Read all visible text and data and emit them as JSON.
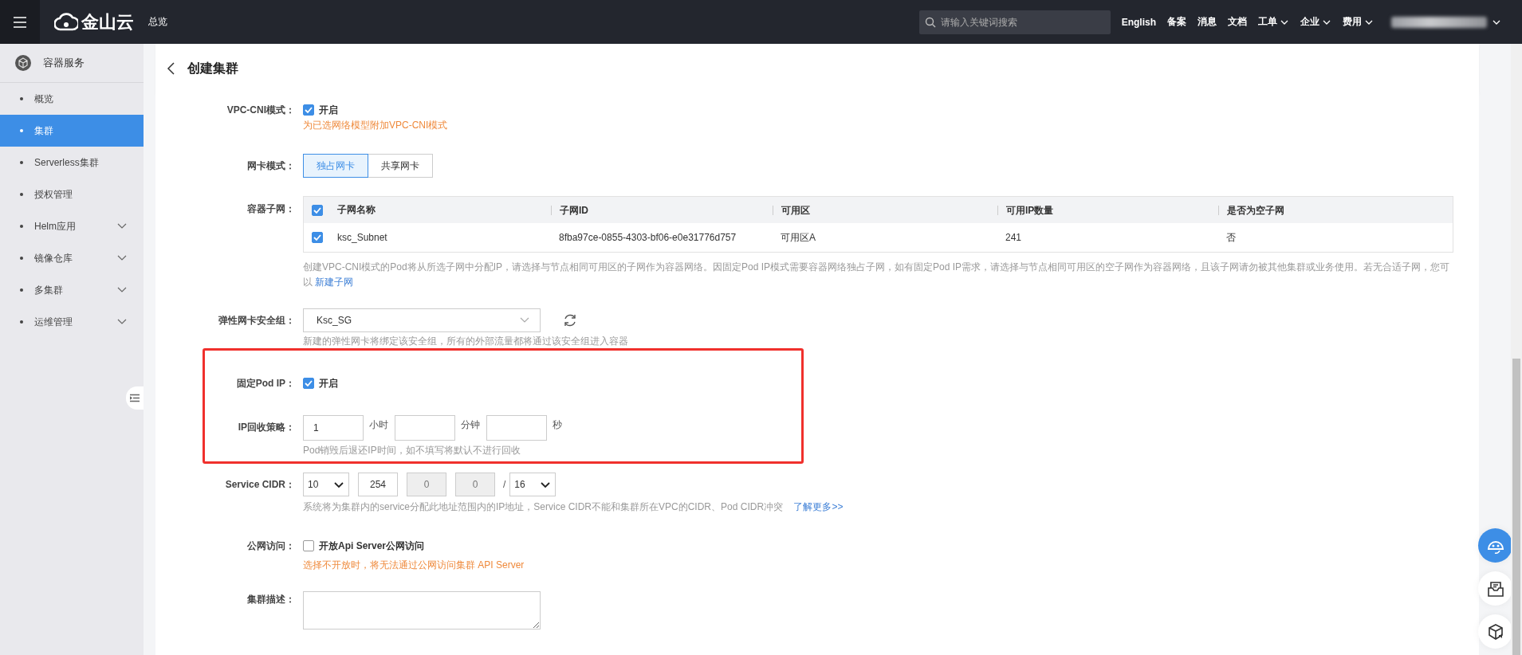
{
  "topbar": {
    "logo_text": "金山云",
    "nav": "总览",
    "search": {
      "placeholder": "请输入关键词搜索"
    },
    "links": [
      {
        "label": "English",
        "dropdown": false
      },
      {
        "label": "备案",
        "dropdown": false
      },
      {
        "label": "消息",
        "dropdown": false
      },
      {
        "label": "文档",
        "dropdown": false
      },
      {
        "label": "工单",
        "dropdown": true
      },
      {
        "label": "企业",
        "dropdown": true
      },
      {
        "label": "费用",
        "dropdown": true
      }
    ]
  },
  "sidebar": {
    "title": "容器服务",
    "items": [
      {
        "label": "概览",
        "selected": false,
        "expandable": false
      },
      {
        "label": "集群",
        "selected": true,
        "expandable": false
      },
      {
        "label": "Serverless集群",
        "selected": false,
        "expandable": false
      },
      {
        "label": "授权管理",
        "selected": false,
        "expandable": false
      },
      {
        "label": "Helm应用",
        "selected": false,
        "expandable": true
      },
      {
        "label": "镜像仓库",
        "selected": false,
        "expandable": true
      },
      {
        "label": "多集群",
        "selected": false,
        "expandable": true
      },
      {
        "label": "运维管理",
        "selected": false,
        "expandable": true
      }
    ]
  },
  "page": {
    "title": "创建集群"
  },
  "form": {
    "vpc_cni": {
      "label": "VPC-CNI模式：",
      "checked": true,
      "option": "开启",
      "hint": {
        "text": "为已选网络模型附加VPC-CNI模式",
        "kind": "warning"
      }
    },
    "nic_mode": {
      "label": "网卡模式：",
      "options": [
        {
          "label": "独占网卡",
          "selected": true
        },
        {
          "label": "共享网卡",
          "selected": false
        }
      ]
    },
    "subnet": {
      "label": "容器子网：",
      "all_checked": true,
      "columns": [
        "子网名称",
        "子网ID",
        "可用区",
        "可用IP数量",
        "是否为空子网"
      ],
      "rows": [
        {
          "checked": true,
          "cells": [
            "ksc_Subnet",
            "8fba97ce-0855-4303-bf06-e0e31776d757",
            "可用区A",
            "241",
            "否"
          ]
        }
      ],
      "hint": {
        "text": "创建VPC-CNI模式的Pod将从所选子网中分配IP，请选择与节点相同可用区的子网作为容器网络。因固定Pod IP模式需要容器网络独占子网，如有固定Pod IP需求，请选择与节点相同可用区的空子网作为容器网络，且该子网请勿被其他集群或业务使用。若无合适子网，您可以",
        "kind": "muted"
      },
      "link": "新建子网"
    },
    "security_group": {
      "label": "弹性网卡安全组：",
      "value": "Ksc_SG",
      "hint": {
        "text": "新建的弹性网卡将绑定该安全组，所有的外部流量都将通过该安全组进入容器",
        "kind": "muted"
      }
    },
    "highlight_box": {
      "highlighted": true,
      "fixed_pod_ip": {
        "label": "固定Pod IP：",
        "checked": true,
        "option": "开启"
      },
      "ip_recycle": {
        "label": "IP回收策略：",
        "fields": [
          {
            "value": "1",
            "unit": "小时"
          },
          {
            "unit": "分钟"
          },
          {
            "unit": "秒"
          }
        ],
        "hint": {
          "text": "Pod销毁后退还IP时间，如不填写将默认不进行回收",
          "kind": "muted"
        }
      }
    },
    "service_cidr": {
      "label": "Service CIDR：",
      "parts": [
        {
          "kind": "select",
          "value": "10"
        },
        {
          "kind": "input",
          "value": "254",
          "disabled": false
        },
        {
          "kind": "input",
          "value": "0",
          "disabled": true
        },
        {
          "kind": "input",
          "value": "0",
          "disabled": true
        },
        {
          "kind": "separator",
          "text": "/"
        },
        {
          "kind": "select",
          "value": "16"
        }
      ],
      "hint": {
        "text": "系统将为集群内的service分配此地址范围内的IP地址，Service CIDR不能和集群所在VPC的CIDR、Pod CIDR冲突",
        "kind": "muted"
      },
      "link": "了解更多>>"
    },
    "public_access": {
      "label": "公网访问：",
      "checked": false,
      "option": "开放Api Server公网访问",
      "hint": {
        "text": "选择不开放时，将无法通过公网访问集群 API Server",
        "kind": "warning"
      }
    },
    "description": {
      "label": "集群描述："
    }
  }
}
